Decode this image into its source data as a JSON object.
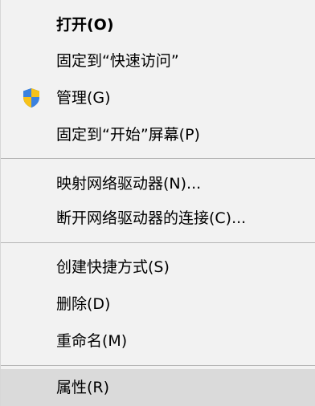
{
  "menu": {
    "items": [
      {
        "label": "打开(O)"
      },
      {
        "label": "固定到“快速访问”"
      },
      {
        "label": "管理(G)",
        "icon": "uac-shield-icon"
      },
      {
        "label": "固定到“开始”屏幕(P)"
      },
      {
        "label": "映射网络驱动器(N)..."
      },
      {
        "label": "断开网络驱动器的连接(C)..."
      },
      {
        "label": "创建快捷方式(S)"
      },
      {
        "label": "删除(D)"
      },
      {
        "label": "重命名(M)"
      },
      {
        "label": "属性(R)"
      }
    ],
    "hover_item": "属性(R)",
    "colors": {
      "background": "#f2f2f2",
      "hover": "#dadada",
      "separator": "#b5b5b5",
      "shield_blue": "#2a6fd1",
      "shield_yellow": "#f7c21a"
    }
  }
}
